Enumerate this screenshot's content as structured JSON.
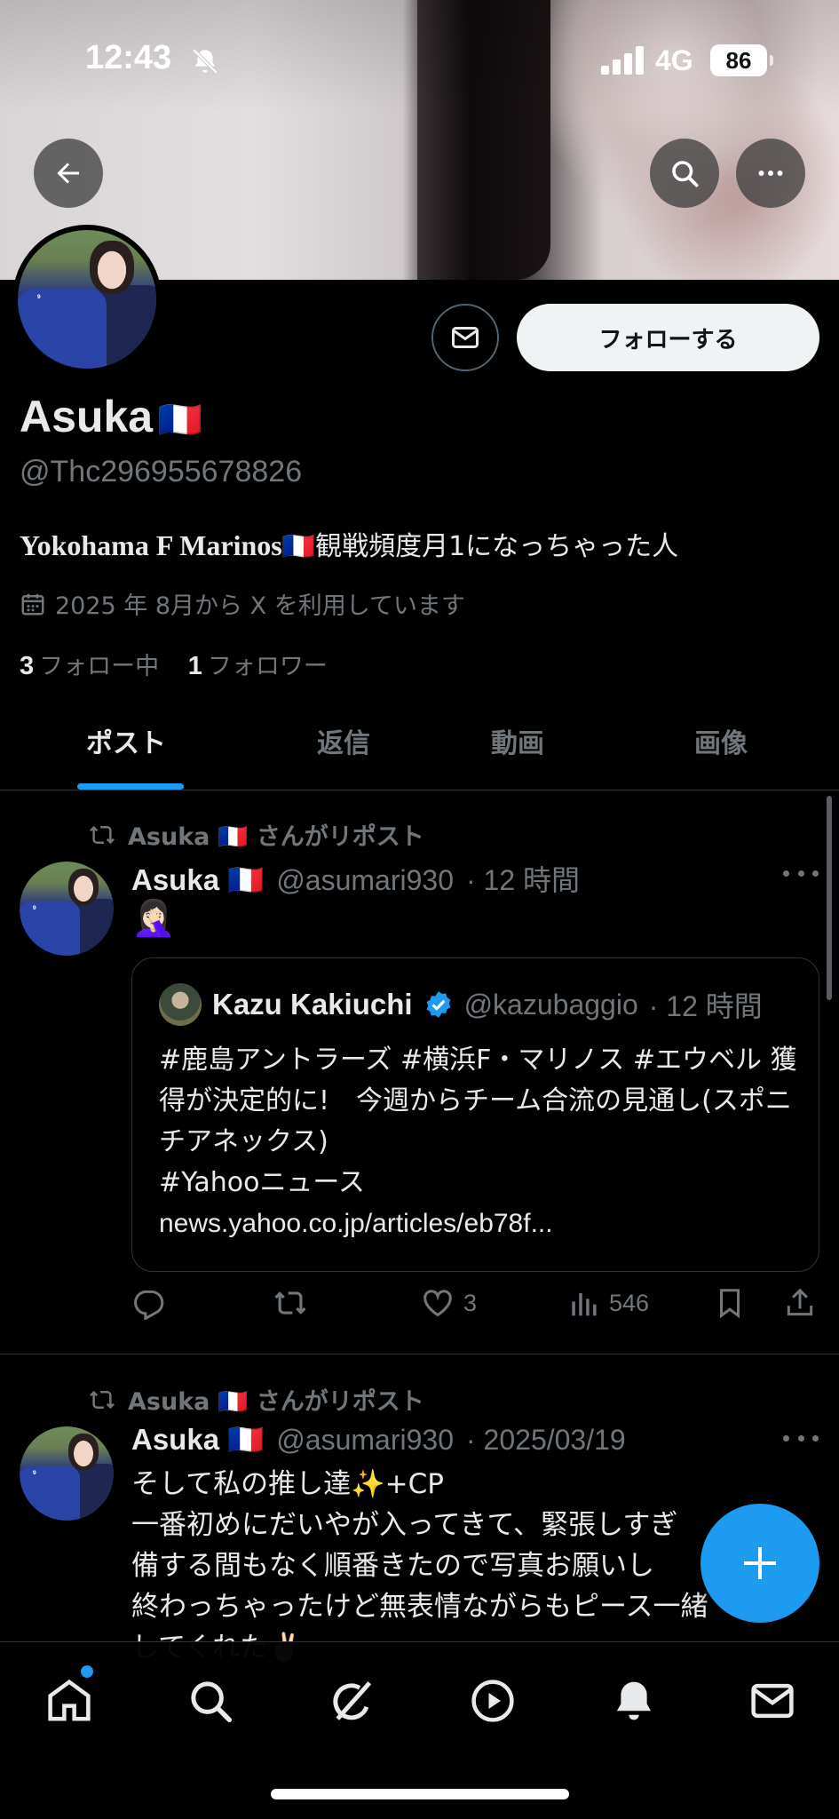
{
  "status_bar": {
    "time": "12:43",
    "network": "4G",
    "battery": "86"
  },
  "profile": {
    "name": "Asuka",
    "flag": "🇫🇷",
    "handle": "@Thc296955678826",
    "bio_latin": "Yokohama F Marinos",
    "bio_rest": "観戦頻度月1になっちゃった人",
    "joined": "2025 年 8月から X を利用しています",
    "following_count": "3",
    "following_label": "フォロー中",
    "followers_count": "1",
    "followers_label": "フォロワー",
    "follow_button": "フォローする"
  },
  "tabs": [
    "ポスト",
    "返信",
    "動画",
    "画像"
  ],
  "posts": [
    {
      "repost_label": "Asuka 🇫🇷 さんがリポスト",
      "author": "Asuka 🇫🇷",
      "handle": "@asumari930",
      "time": "· 12 時間",
      "text": "🤦🏻‍♀️",
      "quote": {
        "author": "Kazu Kakiuchi",
        "handle": "@kazubaggio",
        "time": "· 12 時間",
        "text": "#鹿島アントラーズ #横浜F・マリノス #エウベル 獲得が決定的に!　今週からチーム合流の見通し(スポニチアネックス)",
        "line2": "#Yahooニュース",
        "link": "news.yahoo.co.jp/articles/eb78f..."
      },
      "likes": "3",
      "views": "546"
    },
    {
      "repost_label": "Asuka 🇫🇷 さんがリポスト",
      "author": "Asuka 🇫🇷",
      "handle": "@asumari930",
      "time": "· 2025/03/19",
      "line1": "そして私の推し達✨+CP",
      "line2": "一番初めにだいやが入ってきて、緊張しすぎ",
      "line3": "備する間もなく順番きたので写真お願いし",
      "line4": "終わっちゃったけど無表情ながらもピース一緒",
      "line5": "してくれた✌🏻"
    }
  ],
  "colors": {
    "accent": "#1d9bf0",
    "muted": "#71767b",
    "divider": "#2f3336"
  }
}
